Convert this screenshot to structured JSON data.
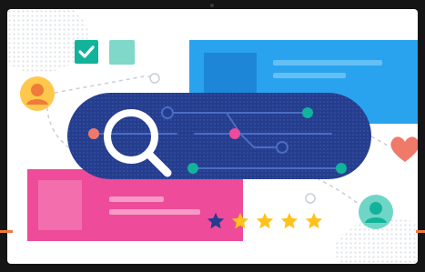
{
  "illustration": {
    "icons": {
      "magnifier": "magnifier-icon",
      "checkbox": "checkbox-checked-icon",
      "user_left": "user-avatar-icon",
      "user_right": "user-avatar-icon",
      "heart": "heart-icon",
      "star": "star-icon"
    },
    "rating": {
      "filled_stars": 4,
      "total_stars": 5
    },
    "colors": {
      "navy": "#243d8f",
      "blue": "#2aa3ee",
      "pink": "#ee4b9a",
      "teal": "#12b39a",
      "yellow": "#ffc84a",
      "coral": "#f07a6a",
      "star_gold": "#ffc21a",
      "star_dim": "#243d8f"
    }
  }
}
